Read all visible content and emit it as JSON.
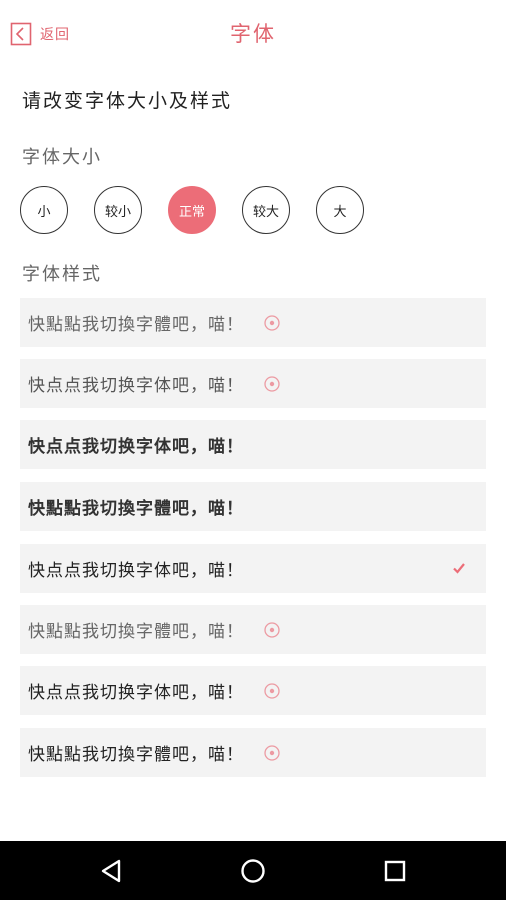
{
  "header": {
    "back_label": "返回",
    "title": "字体"
  },
  "prompt": "请改变字体大小及样式",
  "size_section": {
    "label": "字体大小",
    "options": [
      "小",
      "较小",
      "正常",
      "较大",
      "大"
    ],
    "selected": "正常"
  },
  "style_section": {
    "label": "字体样式",
    "styles": [
      {
        "text": "快點點我切換字體吧，喵！",
        "state": "download"
      },
      {
        "text": "快点点我切换字体吧，喵！",
        "state": "download"
      },
      {
        "text": "快点点我切换字体吧，喵！",
        "state": "available"
      },
      {
        "text": "快點點我切換字體吧，喵！",
        "state": "available"
      },
      {
        "text": "快点点我切换字体吧，喵！",
        "state": "selected"
      },
      {
        "text": "快點點我切換字體吧，喵！",
        "state": "download"
      },
      {
        "text": "快点点我切换字体吧，喵！",
        "state": "download"
      },
      {
        "text": "快點點我切換字體吧，喵！",
        "state": "download"
      }
    ]
  },
  "colors": {
    "accent": "#ec6d78",
    "row_bg": "#f3f3f3",
    "navbar": "#000000"
  },
  "icons": {
    "back": "back-arrow-icon",
    "download": "download-circle-icon",
    "selected": "check-icon",
    "nav": [
      "nav-back-icon",
      "nav-home-icon",
      "nav-recents-icon"
    ]
  }
}
